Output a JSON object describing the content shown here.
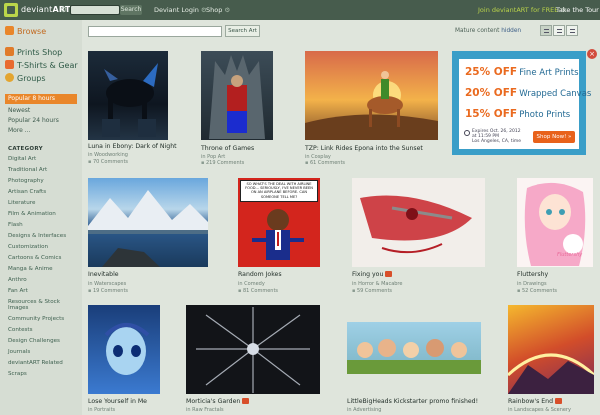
{
  "topbar": {
    "brand_a": "deviant",
    "brand_b": "ART",
    "search_btn": "Search",
    "login": "Deviant Login",
    "shop": "Shop",
    "join": "Join deviantART for FREE",
    "tour": "Take the Tour"
  },
  "sidebar": {
    "browse": "Browse",
    "prints": "Prints Shop",
    "tshirts": "T-Shirts & Gear",
    "groups": "Groups",
    "sort": [
      "Popular 8 hours",
      "Newest",
      "Popular 24 hours",
      "More ..."
    ],
    "category_head": "CATEGORY",
    "categories": [
      "Digital Art",
      "Traditional Art",
      "Photography",
      "Artisan Crafts",
      "Literature",
      "Film & Animation",
      "Flash",
      "Designs & Interfaces",
      "Customization",
      "Cartoons & Comics",
      "Manga & Anime",
      "Anthro",
      "Fan Art",
      "Resources & Stock Images",
      "Community Projects",
      "Contests",
      "Design Challenges",
      "Journals",
      "deviantART Related",
      "Scraps"
    ]
  },
  "toolbar": {
    "search_btn": "Search Art",
    "mature_label": "Mature content",
    "mature_value": "hidden"
  },
  "ad": {
    "l1_pct": "25% OFF",
    "l1_txt": "Fine Art Prints",
    "l2_pct": "20% OFF",
    "l2_txt": "Wrapped Canvas",
    "l3_pct": "15% OFF",
    "l3_txt": "Photo Prints",
    "exp1": "Expires Oct. 26, 2012",
    "exp2": "at 11:59 PM",
    "exp3": "Los Angeles, CA, time",
    "shop": "Shop Now! »"
  },
  "thumbs": [
    {
      "title": "Luna in Ebony: Dark of Night",
      "cat": "in Woodworking",
      "comments": "70 Comments"
    },
    {
      "title": "Throne of Games",
      "cat": "in Pop Art",
      "comments": "219 Comments"
    },
    {
      "title": "TZP: Link Rides Epona into the Sunset",
      "cat": "in Cosplay",
      "comments": "61 Comments"
    },
    {
      "title": "Inevitable",
      "cat": "in Waterscapes",
      "comments": "19 Comments"
    },
    {
      "title": "Random Jokes",
      "cat": "in Comedy",
      "comments": "81 Comments"
    },
    {
      "title": "Fixing you",
      "cat": "in Horror & Macabre",
      "comments": "59 Comments"
    },
    {
      "title": "Fluttershy",
      "cat": "in Drawings",
      "comments": "52 Comments"
    },
    {
      "title": "Lose Yourself in Me",
      "cat": "in Portraits",
      "comments": "63 Comments"
    },
    {
      "title": "Morticia's Garden",
      "cat": "in Raw Fractals",
      "comments": "47 Comments"
    },
    {
      "title": "LittleBigHeads Kickstarter promo finished!",
      "cat": "in Advertising",
      "comments": "22 Comments"
    },
    {
      "title": "Rainbow's End",
      "cat": "in Landscapes & Scenery",
      "comments": "33 Comments"
    }
  ],
  "comic_text": "SO WHAT'S THE DEAL WITH AIRLINE FOOD... SERIOUSLY, I'VE NEVER BEEN ON AN AIRPLANE BEFORE. CAN SOMEONE TELL ME?",
  "fluttershy_sign": "Fluttershy",
  "colors": {
    "topbar": "#475c4d",
    "accent_green": "#b9d24a",
    "popular_orange": "#e9862a",
    "ad_blue": "#3a9ec8",
    "ad_orange": "#ea6a1f"
  }
}
